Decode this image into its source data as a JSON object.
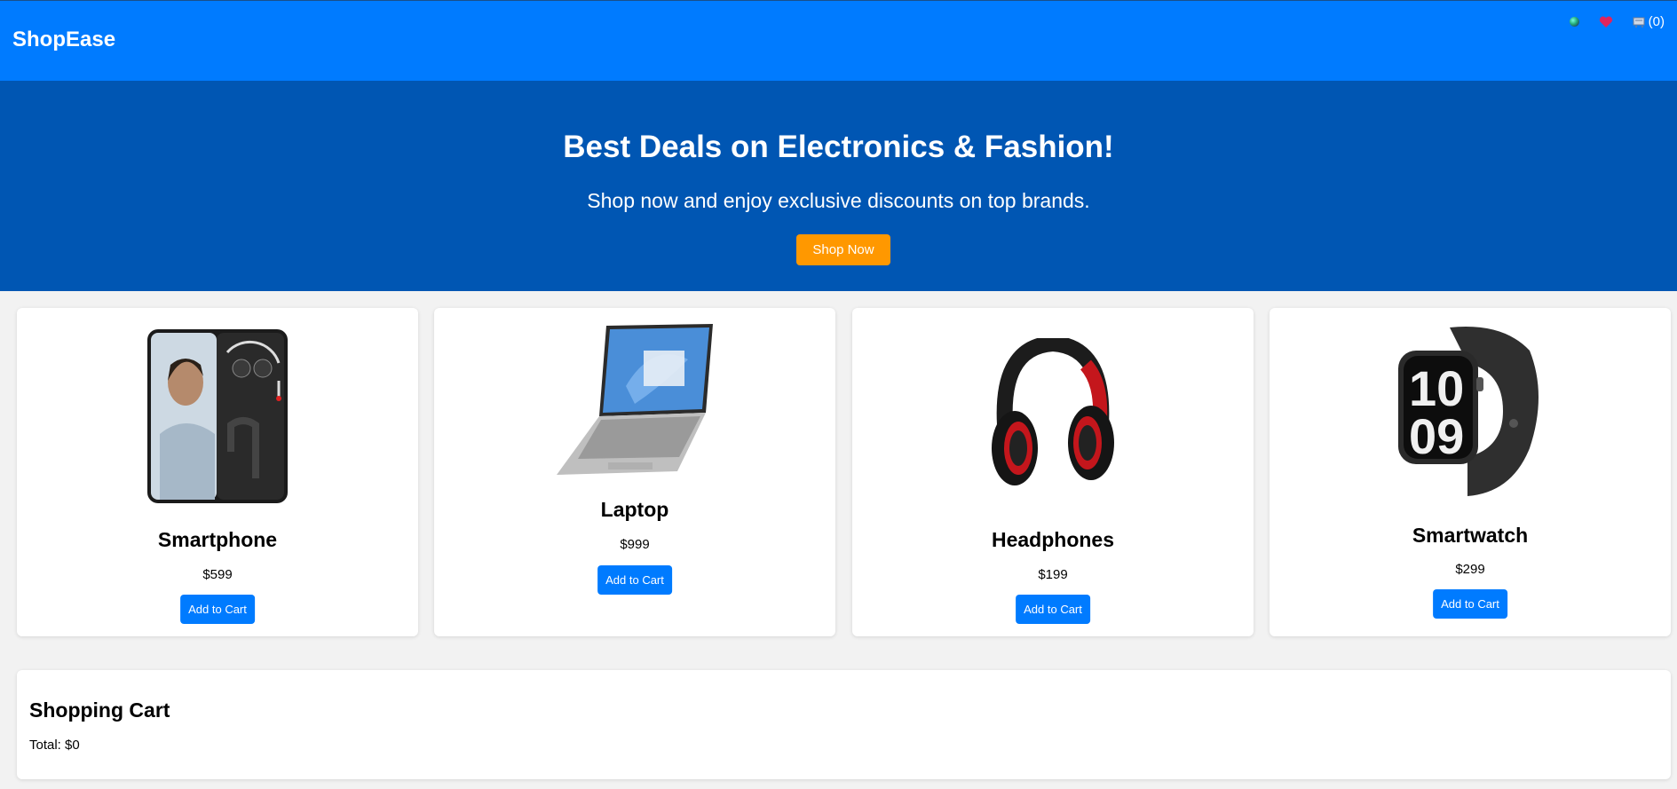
{
  "header": {
    "brand": "ShopEase",
    "cart_count": "(0)",
    "icons": [
      "globe-icon",
      "heart-icon",
      "cart-icon"
    ]
  },
  "hero": {
    "title": "Best Deals on Electronics & Fashion!",
    "subtitle": "Shop now and enjoy exclusive discounts on top brands.",
    "button": "Shop Now"
  },
  "products": [
    {
      "name": "Smartphone",
      "price": "$599",
      "button": "Add to Cart"
    },
    {
      "name": "Laptop",
      "price": "$999",
      "button": "Add to Cart"
    },
    {
      "name": "Headphones",
      "price": "$199",
      "button": "Add to Cart"
    },
    {
      "name": "Smartwatch",
      "price": "$299",
      "button": "Add to Cart"
    }
  ],
  "cart": {
    "title": "Shopping Cart",
    "total": "Total: $0"
  },
  "colors": {
    "header": "#007bff",
    "hero": "#0056b3",
    "accent_button": "#ff9800",
    "primary_button": "#007bff"
  }
}
